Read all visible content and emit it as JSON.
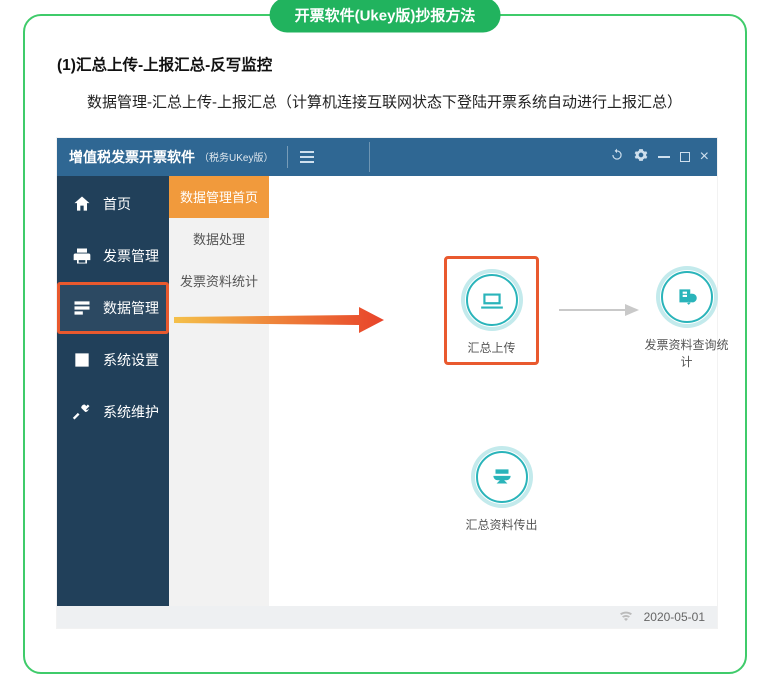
{
  "pill_title": "开票软件(Ukey版)抄报方法",
  "section": {
    "heading": "(1)汇总上传-上报汇总-反写监控",
    "desc": "数据管理-汇总上传-上报汇总（计算机连接互联网状态下登陆开票系统自动进行上报汇总）"
  },
  "app": {
    "title": "增值税发票开票软件",
    "subtitle": "（税务UKey版）",
    "sidebar": [
      {
        "label": "首页"
      },
      {
        "label": "发票管理"
      },
      {
        "label": "数据管理"
      },
      {
        "label": "系统设置"
      },
      {
        "label": "系统维护"
      }
    ],
    "subsidebar": [
      {
        "label": "数据管理首页"
      },
      {
        "label": "数据处理"
      },
      {
        "label": "发票资料统计"
      }
    ],
    "cards": {
      "upload": "汇总上传",
      "query": "发票资料查询统计",
      "export": "汇总资料传出"
    },
    "status_date": "2020-05-01"
  }
}
